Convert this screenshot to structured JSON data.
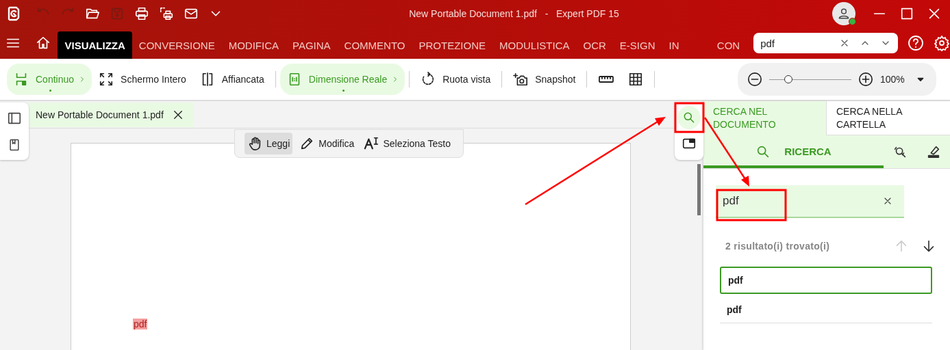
{
  "window": {
    "title": "New Portable Document 1.pdf   -   Expert PDF 15"
  },
  "quick_access": [
    {
      "kind": "undo",
      "disabled": true
    },
    {
      "kind": "redo",
      "disabled": true
    },
    {
      "kind": "open",
      "disabled": false
    },
    {
      "kind": "save",
      "disabled": true
    },
    {
      "kind": "print",
      "disabled": false
    },
    {
      "kind": "batch-print",
      "disabled": false
    },
    {
      "kind": "mail",
      "disabled": false
    },
    {
      "kind": "more",
      "disabled": false
    }
  ],
  "menu": {
    "tabs": [
      {
        "label": "VISUALIZZA",
        "selected": true
      },
      {
        "label": "CONVERSIONE",
        "selected": false
      },
      {
        "label": "MODIFICA",
        "selected": false
      },
      {
        "label": "PAGINA",
        "selected": false
      },
      {
        "label": "COMMENTO",
        "selected": false
      },
      {
        "label": "PROTEZIONE",
        "selected": false
      },
      {
        "label": "MODULISTICA",
        "selected": false
      },
      {
        "label": "OCR",
        "selected": false
      },
      {
        "label": "E-SIGN",
        "selected": false
      },
      {
        "label": "IN",
        "selected": false
      },
      {
        "label": "CON",
        "selected": false
      }
    ],
    "search_field": {
      "value": "pdf"
    }
  },
  "toolbar": {
    "buttons": [
      {
        "kind": "continuous",
        "label": "Continuo",
        "selected": true
      },
      {
        "kind": "fullscreen",
        "label": "Schermo Intero",
        "selected": false
      },
      {
        "kind": "side",
        "label": "Affiancata",
        "selected": false
      },
      {
        "kind": "actual",
        "label": "Dimensione Reale",
        "selected": true
      },
      {
        "kind": "rotate",
        "label": "Ruota vista",
        "selected": false
      },
      {
        "kind": "snapshot",
        "label": "Snapshot",
        "selected": false
      }
    ],
    "zoom": {
      "level": 0.23,
      "reading": "100%"
    }
  },
  "document_tab": {
    "label": "New Portable Document 1.pdf"
  },
  "mode_bar": [
    {
      "kind": "read",
      "label": "Leggi",
      "selected": true
    },
    {
      "kind": "edit",
      "label": "Modifica",
      "selected": false
    },
    {
      "kind": "select",
      "label": "Seleziona Testo",
      "selected": false
    }
  ],
  "page": {
    "highlight": "pdf"
  },
  "panel": {
    "tabs": [
      {
        "label": "CERCA NEL DOCUMENTO",
        "selected": true
      },
      {
        "label": "CERCA NELLA CARTELLA",
        "selected": false
      }
    ],
    "subtab": "RICERCA",
    "search": {
      "value": "pdf"
    },
    "results_count": "2 risultato(i) trovato(i)",
    "prev_disabled": true,
    "next_disabled": false,
    "results": [
      {
        "text": "pdf",
        "selected": true
      },
      {
        "text": "pdf",
        "selected": false
      }
    ]
  }
}
